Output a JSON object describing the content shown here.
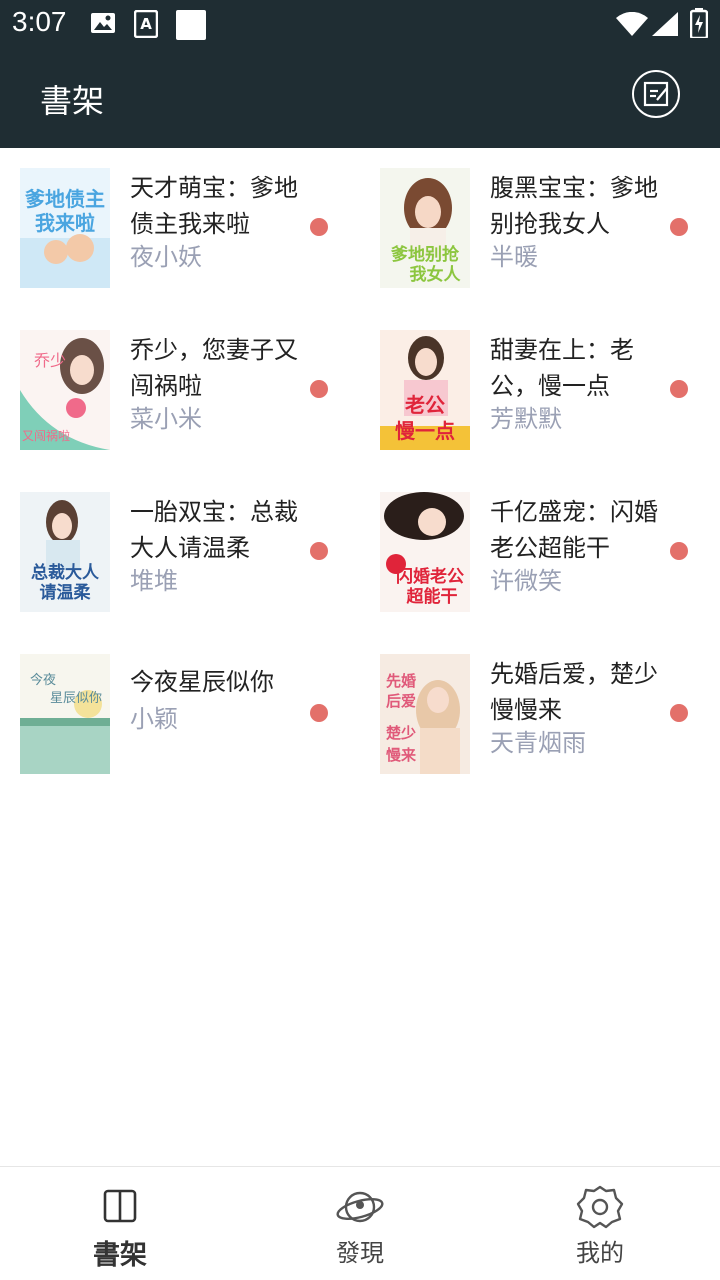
{
  "status_bar": {
    "time": "3:07"
  },
  "header": {
    "title": "書架",
    "edit_icon": "edit-note-icon"
  },
  "books": [
    {
      "title": "天才萌宝：爹地债主我来啦",
      "author": "夜小妖",
      "cover_text": "爹地债主我来啦",
      "cover_color": "#4aa5e0"
    },
    {
      "title": "腹黑宝宝：爹地别抢我女人",
      "author": "半暖",
      "cover_text": "爹地别抢我女人",
      "cover_color": "#8cc63f"
    },
    {
      "title": "乔少，您妻子又闯祸啦",
      "author": "菜小米",
      "cover_text": "又闯祸啦",
      "cover_color": "#f06a8a"
    },
    {
      "title": "甜妻在上：老公，慢一点",
      "author": "芳默默",
      "cover_text": "老公慢一点",
      "cover_color": "#e0243a"
    },
    {
      "title": "一胎双宝：总裁大人请温柔",
      "author": "堆堆",
      "cover_text": "总裁大人请温柔",
      "cover_color": "#4a7fb8"
    },
    {
      "title": "千亿盛宠：闪婚老公超能干",
      "author": "许微笑",
      "cover_text": "闪婚老公超能干",
      "cover_color": "#e0243a"
    },
    {
      "title": "今夜星辰似你",
      "author": "小颖",
      "cover_text": "今夜星辰似你",
      "cover_color": "#7fb6a8"
    },
    {
      "title": "先婚后爱，楚少慢慢来",
      "author": "天青烟雨",
      "cover_text": "楚少慢慢来",
      "cover_color": "#e05a7a"
    }
  ],
  "colors": {
    "header_bg": "#1f2d33",
    "update_dot": "#e3706a",
    "author_text": "#9aa0b4"
  },
  "bottom_nav": [
    {
      "label": "書架",
      "icon": "book-open-icon",
      "active": true
    },
    {
      "label": "發現",
      "icon": "planet-icon",
      "active": false
    },
    {
      "label": "我的",
      "icon": "settings-gear-icon",
      "active": false
    }
  ]
}
